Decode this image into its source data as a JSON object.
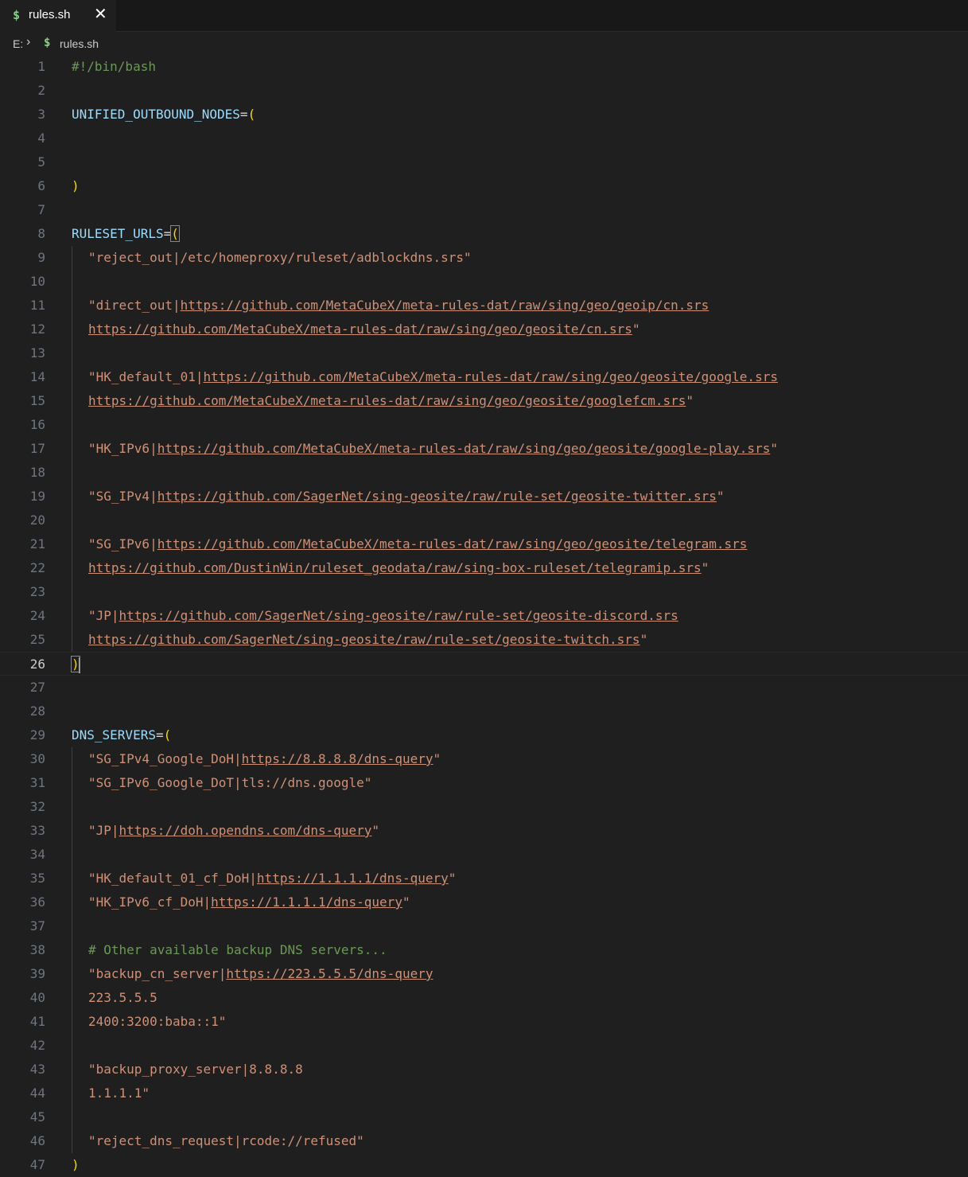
{
  "tab": {
    "icon": "$",
    "label": "rules.sh",
    "close": "✕"
  },
  "breadcrumb": {
    "drive": "E:",
    "separator": "›",
    "icon": "$",
    "file": "rules.sh"
  },
  "colors": {
    "accent_icon": "#89d185",
    "bracket": "#ffd700",
    "variable": "#9cdcfe",
    "string": "#ce9178",
    "comment": "#6a9955"
  },
  "active_line": "26",
  "lines": [
    {
      "n": "1",
      "indent": false,
      "tokens": [
        {
          "t": "#!/bin/bash",
          "c": "com"
        }
      ]
    },
    {
      "n": "2",
      "indent": false,
      "tokens": []
    },
    {
      "n": "3",
      "indent": false,
      "tokens": [
        {
          "t": "UNIFIED_OUTBOUND_NODES",
          "c": "var"
        },
        {
          "t": "=",
          "c": "op"
        },
        {
          "t": "(",
          "c": "br"
        }
      ]
    },
    {
      "n": "4",
      "indent": false,
      "tokens": []
    },
    {
      "n": "5",
      "indent": false,
      "tokens": []
    },
    {
      "n": "6",
      "indent": false,
      "tokens": [
        {
          "t": ")",
          "c": "br"
        }
      ]
    },
    {
      "n": "7",
      "indent": false,
      "tokens": []
    },
    {
      "n": "8",
      "indent": false,
      "tokens": [
        {
          "t": "RULESET_URLS",
          "c": "var"
        },
        {
          "t": "=",
          "c": "op"
        },
        {
          "t": "(",
          "c": "br match"
        }
      ]
    },
    {
      "n": "9",
      "indent": true,
      "tokens": [
        {
          "t": "\"reject_out|/etc/homeproxy/ruleset/adblockdns.srs\"",
          "c": "str"
        }
      ]
    },
    {
      "n": "10",
      "indent": true,
      "tokens": []
    },
    {
      "n": "11",
      "indent": true,
      "tokens": [
        {
          "t": "\"direct_out|",
          "c": "str"
        },
        {
          "t": "https://github.com/MetaCubeX/meta-rules-dat/raw/sing/geo/geoip/cn.srs",
          "c": "url"
        }
      ]
    },
    {
      "n": "12",
      "indent": true,
      "tokens": [
        {
          "t": "https://github.com/MetaCubeX/meta-rules-dat/raw/sing/geo/geosite/cn.srs",
          "c": "url"
        },
        {
          "t": "\"",
          "c": "str"
        }
      ]
    },
    {
      "n": "13",
      "indent": true,
      "tokens": []
    },
    {
      "n": "14",
      "indent": true,
      "tokens": [
        {
          "t": "\"HK_default_01|",
          "c": "str"
        },
        {
          "t": "https://github.com/MetaCubeX/meta-rules-dat/raw/sing/geo/geosite/google.srs",
          "c": "url"
        }
      ]
    },
    {
      "n": "15",
      "indent": true,
      "tokens": [
        {
          "t": "https://github.com/MetaCubeX/meta-rules-dat/raw/sing/geo/geosite/googlefcm.srs",
          "c": "url"
        },
        {
          "t": "\"",
          "c": "str"
        }
      ]
    },
    {
      "n": "16",
      "indent": true,
      "tokens": []
    },
    {
      "n": "17",
      "indent": true,
      "tokens": [
        {
          "t": "\"HK_IPv6|",
          "c": "str"
        },
        {
          "t": "https://github.com/MetaCubeX/meta-rules-dat/raw/sing/geo/geosite/google-play.srs",
          "c": "url"
        },
        {
          "t": "\"",
          "c": "str"
        }
      ]
    },
    {
      "n": "18",
      "indent": true,
      "tokens": []
    },
    {
      "n": "19",
      "indent": true,
      "tokens": [
        {
          "t": "\"SG_IPv4|",
          "c": "str"
        },
        {
          "t": "https://github.com/SagerNet/sing-geosite/raw/rule-set/geosite-twitter.srs",
          "c": "url"
        },
        {
          "t": "\"",
          "c": "str"
        }
      ]
    },
    {
      "n": "20",
      "indent": true,
      "tokens": []
    },
    {
      "n": "21",
      "indent": true,
      "tokens": [
        {
          "t": "\"SG_IPv6|",
          "c": "str"
        },
        {
          "t": "https://github.com/MetaCubeX/meta-rules-dat/raw/sing/geo/geosite/telegram.srs",
          "c": "url"
        }
      ]
    },
    {
      "n": "22",
      "indent": true,
      "tokens": [
        {
          "t": "https://github.com/DustinWin/ruleset_geodata/raw/sing-box-ruleset/telegramip.srs",
          "c": "url"
        },
        {
          "t": "\"",
          "c": "str"
        }
      ]
    },
    {
      "n": "23",
      "indent": true,
      "tokens": []
    },
    {
      "n": "24",
      "indent": true,
      "tokens": [
        {
          "t": "\"JP|",
          "c": "str"
        },
        {
          "t": "https://github.com/SagerNet/sing-geosite/raw/rule-set/geosite-discord.srs",
          "c": "url"
        }
      ]
    },
    {
      "n": "25",
      "indent": true,
      "tokens": [
        {
          "t": "https://github.com/SagerNet/sing-geosite/raw/rule-set/geosite-twitch.srs",
          "c": "url"
        },
        {
          "t": "\"",
          "c": "str"
        }
      ]
    },
    {
      "n": "26",
      "indent": false,
      "cursor": true,
      "tokens": [
        {
          "t": ")",
          "c": "br match"
        }
      ]
    },
    {
      "n": "27",
      "indent": false,
      "tokens": []
    },
    {
      "n": "28",
      "indent": false,
      "tokens": []
    },
    {
      "n": "29",
      "indent": false,
      "tokens": [
        {
          "t": "DNS_SERVERS",
          "c": "var"
        },
        {
          "t": "=",
          "c": "op"
        },
        {
          "t": "(",
          "c": "br"
        }
      ]
    },
    {
      "n": "30",
      "indent": true,
      "tokens": [
        {
          "t": "\"SG_IPv4_Google_DoH|",
          "c": "str"
        },
        {
          "t": "https://8.8.8.8/dns-query",
          "c": "url"
        },
        {
          "t": "\"",
          "c": "str"
        }
      ]
    },
    {
      "n": "31",
      "indent": true,
      "tokens": [
        {
          "t": "\"SG_IPv6_Google_DoT|tls://dns.google\"",
          "c": "str"
        }
      ]
    },
    {
      "n": "32",
      "indent": true,
      "tokens": []
    },
    {
      "n": "33",
      "indent": true,
      "tokens": [
        {
          "t": "\"JP|",
          "c": "str"
        },
        {
          "t": "https://doh.opendns.com/dns-query",
          "c": "url"
        },
        {
          "t": "\"",
          "c": "str"
        }
      ]
    },
    {
      "n": "34",
      "indent": true,
      "tokens": []
    },
    {
      "n": "35",
      "indent": true,
      "tokens": [
        {
          "t": "\"HK_default_01_cf_DoH|",
          "c": "str"
        },
        {
          "t": "https://1.1.1.1/dns-query",
          "c": "url"
        },
        {
          "t": "\"",
          "c": "str"
        }
      ]
    },
    {
      "n": "36",
      "indent": true,
      "tokens": [
        {
          "t": "\"HK_IPv6_cf_DoH|",
          "c": "str"
        },
        {
          "t": "https://1.1.1.1/dns-query",
          "c": "url"
        },
        {
          "t": "\"",
          "c": "str"
        }
      ]
    },
    {
      "n": "37",
      "indent": true,
      "tokens": []
    },
    {
      "n": "38",
      "indent": true,
      "tokens": [
        {
          "t": "# Other available backup DNS servers...",
          "c": "com"
        }
      ]
    },
    {
      "n": "39",
      "indent": true,
      "tokens": [
        {
          "t": "\"backup_cn_server|",
          "c": "str"
        },
        {
          "t": "https://223.5.5.5/dns-query",
          "c": "url"
        }
      ]
    },
    {
      "n": "40",
      "indent": true,
      "tokens": [
        {
          "t": "223.5.5.5",
          "c": "str"
        }
      ]
    },
    {
      "n": "41",
      "indent": true,
      "tokens": [
        {
          "t": "2400:3200:baba::1\"",
          "c": "str"
        }
      ]
    },
    {
      "n": "42",
      "indent": true,
      "tokens": []
    },
    {
      "n": "43",
      "indent": true,
      "tokens": [
        {
          "t": "\"backup_proxy_server|8.8.8.8",
          "c": "str"
        }
      ]
    },
    {
      "n": "44",
      "indent": true,
      "tokens": [
        {
          "t": "1.1.1.1\"",
          "c": "str"
        }
      ]
    },
    {
      "n": "45",
      "indent": true,
      "tokens": []
    },
    {
      "n": "46",
      "indent": true,
      "tokens": [
        {
          "t": "\"reject_dns_request|rcode://refused\"",
          "c": "str"
        }
      ]
    },
    {
      "n": "47",
      "indent": false,
      "tokens": [
        {
          "t": ")",
          "c": "br"
        }
      ]
    }
  ]
}
